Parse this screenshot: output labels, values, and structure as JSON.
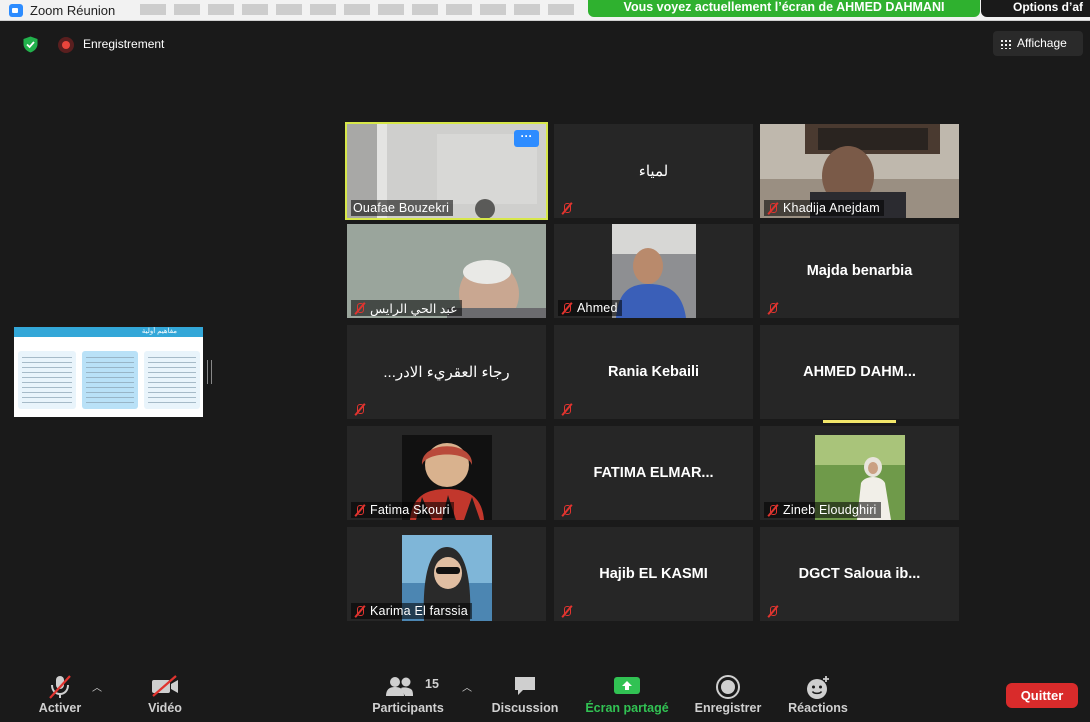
{
  "window": {
    "title": "Zoom Réunion"
  },
  "banner": {
    "sharing_text": "Vous voyez actuellement l’écran de AHMED DAHMANI",
    "options_label": "Options d’af"
  },
  "topbar": {
    "recording_label": "Enregistrement",
    "view_label": "Affichage"
  },
  "shared_thumbnail": {
    "header_text": "مفاهيم أولية"
  },
  "tiles": [
    {
      "name": "Ouafae Bouzekri",
      "type": "video",
      "active": true
    },
    {
      "name": "لمياء",
      "type": "name"
    },
    {
      "name": "Khadija Anejdam",
      "type": "video"
    },
    {
      "name": "عبد الحي الرايس",
      "type": "video"
    },
    {
      "name": "Ahmed",
      "type": "video"
    },
    {
      "name": "Majda benarbia",
      "type": "name"
    },
    {
      "name": "...رجاء العقريء الادر",
      "type": "name"
    },
    {
      "name": "Rania Kebaili",
      "type": "name"
    },
    {
      "name": "AHMED  DAHM...",
      "type": "name",
      "speaking": true
    },
    {
      "name": "Fatima Skouri",
      "type": "video"
    },
    {
      "name": "FATIMA ELMAR...",
      "type": "name"
    },
    {
      "name": "Zineb Eloudghiri",
      "type": "video"
    },
    {
      "name": "Karima El farssia",
      "type": "video"
    },
    {
      "name": "Hajib EL KASMI",
      "type": "name"
    },
    {
      "name": "DGCT  Saloua ib...",
      "type": "name"
    }
  ],
  "toolbar": {
    "mute_label": "Activer",
    "video_label": "Vidéo",
    "participants_label": "Participants",
    "participants_count": "15",
    "chat_label": "Discussion",
    "share_label": "Écran partagé",
    "record_label": "Enregistrer",
    "reactions_label": "Réactions",
    "quit_label": "Quitter"
  },
  "colors": {
    "share_green": "#2fb12f",
    "active_speaker": "#d7e74a",
    "quit_red": "#d92b2b",
    "mic_off_red": "#e0342f"
  }
}
